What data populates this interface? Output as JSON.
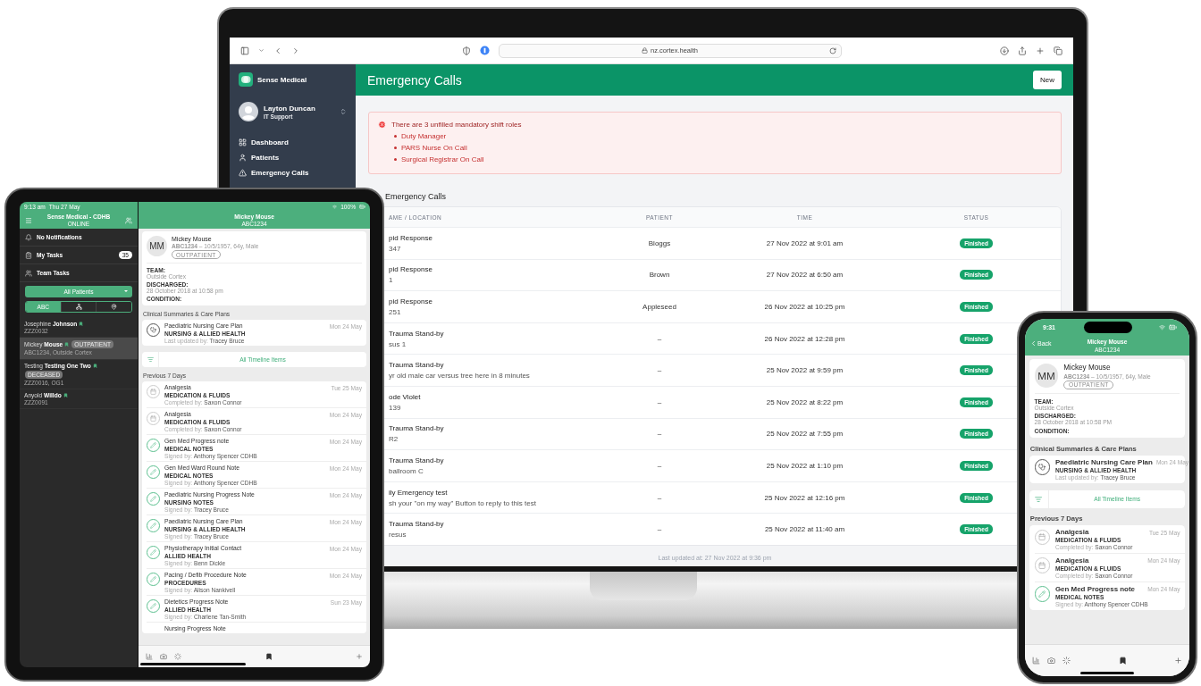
{
  "laptop": {
    "browser": {
      "url": "nz.cortex.health"
    },
    "sidebar": {
      "brand": "Sense Medical",
      "user_name": "Layton Duncan",
      "user_role": "IT Support",
      "items": [
        {
          "kind": "dashboard",
          "label": "Dashboard"
        },
        {
          "kind": "patients",
          "label": "Patients"
        },
        {
          "kind": "emergency",
          "label": "Emergency Calls"
        }
      ]
    },
    "header": {
      "title": "Emergency Calls",
      "button": "New"
    },
    "alert": {
      "title": "There are 3 unfilled mandatory shift roles",
      "items": [
        "Duty Manager",
        "PARS Nurse On Call",
        "Surgical Registrar On Call"
      ]
    },
    "section_title": "Emergency Calls",
    "table": {
      "columns": [
        "AME / LOCATION",
        "PATIENT",
        "TIME",
        "STATUS"
      ],
      "rows": [
        {
          "name": "pid Response",
          "location": "347",
          "patient": "Bloggs",
          "time": "27 Nov 2022 at 9:01 am",
          "status": "Finished"
        },
        {
          "name": "pid Response",
          "location": "1",
          "patient": "Brown",
          "time": "27 Nov 2022 at 6:50 am",
          "status": "Finished"
        },
        {
          "name": "pid Response",
          "location": "251",
          "patient": "Appleseed",
          "time": "26 Nov 2022 at 10:25 pm",
          "status": "Finished"
        },
        {
          "name": "Trauma Stand-by",
          "location": "sus 1",
          "patient": "–",
          "time": "26 Nov 2022 at 12:28 pm",
          "status": "Finished"
        },
        {
          "name": "Trauma Stand-by",
          "location": "yr old male car versus tree here in 8 minutes",
          "patient": "–",
          "time": "25 Nov 2022 at 9:59 pm",
          "status": "Finished"
        },
        {
          "name": "ode Violet",
          "location": "139",
          "patient": "–",
          "time": "25 Nov 2022 at 8:22 pm",
          "status": "Finished"
        },
        {
          "name": "Trauma Stand-by",
          "location": "R2",
          "patient": "–",
          "time": "25 Nov 2022 at 7:55 pm",
          "status": "Finished"
        },
        {
          "name": "Trauma Stand-by",
          "location": "ballroom C",
          "patient": "–",
          "time": "25 Nov 2022 at 1:10 pm",
          "status": "Finished"
        },
        {
          "name": "ily Emergency test",
          "location": "sh your \"on my way\" Button to reply to this test",
          "patient": "–",
          "time": "25 Nov 2022 at 12:16 pm",
          "status": "Finished"
        },
        {
          "name": "Trauma Stand-by",
          "location": "resus",
          "patient": "–",
          "time": "25 Nov 2022 at 11:40 am",
          "status": "Finished"
        }
      ]
    },
    "footer": "Last updated at: 27 Nov 2022 at 9:36 pm"
  },
  "tablet": {
    "status_time": "9:13 am",
    "status_date": "Thu 27 May",
    "battery": "100%",
    "sidebar": {
      "title": "Sense Medical - CDHB",
      "subtitle": "ONLINE",
      "nav": [
        {
          "kind": "notifications",
          "label": "No Notifications"
        },
        {
          "kind": "tasks",
          "label": "My Tasks",
          "count": "35"
        },
        {
          "kind": "team",
          "label": "Team Tasks"
        }
      ],
      "filter": "All Patients",
      "segments": [
        {
          "kind": "text",
          "label": "ABC",
          "selected": true
        },
        {
          "kind": "team",
          "selected": false
        },
        {
          "kind": "location",
          "selected": false
        }
      ],
      "patients": [
        {
          "name": "Josephine **Johnson**",
          "detail": "ZZZ0032",
          "selected": false
        },
        {
          "name": "Mickey **Mouse**",
          "detail": "ABC1234, Outside Cortex",
          "badge": "OUTPATIENT",
          "selected": true
        },
        {
          "name": "Testing **Testing One Two**",
          "detail": "ZZZ0016, OG1",
          "badge": "DECEASED",
          "selected": false
        },
        {
          "name": "Anyold **Willdo**",
          "detail": "ZZZ0091",
          "selected": false
        }
      ]
    },
    "detail": {
      "title": "Mickey Mouse",
      "subtitle": "ABC1234",
      "initials": "MM",
      "name": "Mickey Mouse",
      "info": "**ABC1234** – 10/5/1957, 64y, Male",
      "badge": "OUTPATIENT",
      "fields": [
        {
          "label": "TEAM:",
          "value": "Outside Cortex"
        },
        {
          "label": "DISCHARGED:",
          "value": "28 October 2018 at 10:58 pm"
        },
        {
          "label": "CONDITION:"
        }
      ],
      "summary_title": "Clinical Summaries & Care Plans",
      "summaries": [
        {
          "kind": "care_plan",
          "title": "Paediatric Nursing Care Plan",
          "category": "NURSING & ALLIED HEALTH",
          "by": "Last updated by: **Tracey Bruce**",
          "date": "Mon 24 May"
        }
      ],
      "timeline": "All Timeline Items",
      "recent_title": "Previous 7 Days",
      "recent": [
        {
          "kind": "form",
          "title": "Analgesia",
          "category": "MEDICATION & FLUIDS",
          "by": "Completed by: **Saxon Connor**",
          "date": "Tue 25 May"
        },
        {
          "kind": "form",
          "title": "Analgesia",
          "category": "MEDICATION & FLUIDS",
          "by": "Completed by: **Saxon Connor**",
          "date": "Mon 24 May"
        },
        {
          "kind": "note",
          "title": "Gen Med Progress note",
          "category": "MEDICAL NOTES",
          "by": "Signed by: **Anthony Spencer CDHB**",
          "date": "Mon 24 May"
        },
        {
          "kind": "note",
          "title": "Gen Med Ward Round Note",
          "category": "MEDICAL NOTES",
          "by": "Signed by: **Anthony Spencer CDHB**",
          "date": "Mon 24 May"
        },
        {
          "kind": "note",
          "title": "Paediatric Nursing Progress Note",
          "category": "NURSING NOTES",
          "by": "Signed by: **Tracey Bruce**",
          "date": "Mon 24 May"
        },
        {
          "kind": "note",
          "title": "Paediatric Nursing Care Plan",
          "category": "NURSING & ALLIED HEALTH",
          "by": "Signed by: **Tracey Bruce**",
          "date": "Mon 24 May"
        },
        {
          "kind": "note",
          "title": "Physiotherapy Initial Contact",
          "category": "ALLIED HEALTH",
          "by": "Signed by: **Benn Dickie**",
          "date": "Mon 24 May"
        },
        {
          "kind": "note",
          "title": "Pacing / Defib Procedure Note",
          "category": "PROCEDURES",
          "by": "Signed by: **Alison Nankivell**",
          "date": "Mon 24 May"
        },
        {
          "kind": "note",
          "title": "Dietetics Progress Note",
          "category": "ALLIED HEALTH",
          "by": "Signed by: **Charlene Tan-Smith**",
          "date": "Sun 23 May"
        },
        {
          "kind": "partial",
          "title": "Nursing Progress Note"
        }
      ]
    }
  },
  "phone": {
    "status_time": "9:31",
    "back": "Back",
    "detail": {
      "title": "Mickey Mouse",
      "subtitle": "ABC1234",
      "initials": "MM",
      "name": "Mickey Mouse",
      "info": "**ABC1234** – 10/5/1957, 64y, Male",
      "badge": "OUTPATIENT",
      "fields": [
        {
          "label": "TEAM:",
          "value": "Outside Cortex"
        },
        {
          "label": "DISCHARGED:",
          "value": "28 October 2018 at 10:58 PM"
        },
        {
          "label": "CONDITION:"
        }
      ],
      "summary_title": "Clinical Summaries & Care Plans",
      "summaries": [
        {
          "kind": "care_plan",
          "title": "Paediatric Nursing Care Plan",
          "category": "NURSING & ALLIED HEALTH",
          "by": "Last updated by: **Tracey Bruce**",
          "date": "Mon 24 May"
        }
      ],
      "timeline": "All Timeline Items",
      "recent_title": "Previous 7 Days",
      "recent": [
        {
          "kind": "form",
          "title": "Analgesia",
          "category": "MEDICATION & FLUIDS",
          "by": "Completed by: **Saxon Connor**",
          "date": "Tue 25 May"
        },
        {
          "kind": "form",
          "title": "Analgesia",
          "category": "MEDICATION & FLUIDS",
          "by": "Completed by: **Saxon Connor**",
          "date": "Mon 24 May"
        },
        {
          "kind": "note",
          "title": "Gen Med Progress note",
          "category": "MEDICAL NOTES",
          "by": "Signed by: **Anthony Spencer CDHB**",
          "date": "Mon 24 May"
        }
      ]
    }
  }
}
